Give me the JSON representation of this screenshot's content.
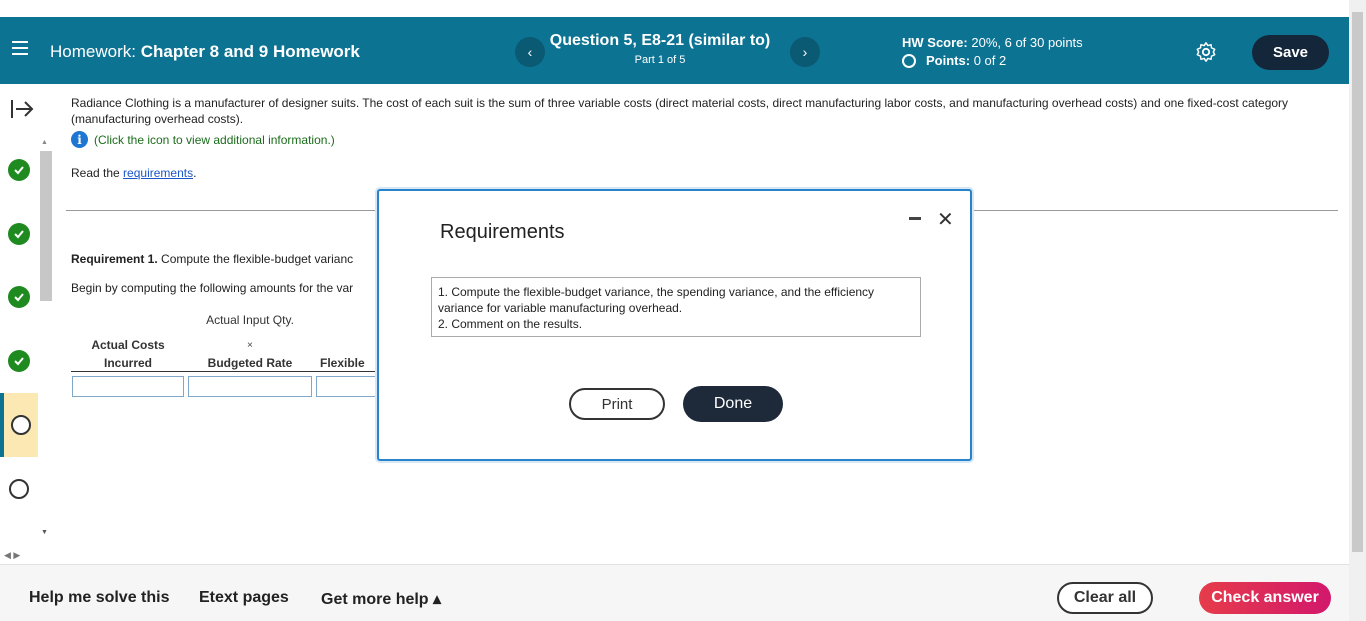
{
  "header": {
    "title_prefix": "Homework:",
    "title_name": "Chapter 8 and 9 Homework",
    "question_title": "Question 5, E8-21 (similar to)",
    "question_part": "Part 1 of 5",
    "hw_score_label": "HW Score:",
    "hw_score_value": "20%, 6 of 30 points",
    "points_label": "Points:",
    "points_value": "0 of 2",
    "prev_label": "‹",
    "next_label": "›",
    "save_label": "Save"
  },
  "sidebar": {
    "items": [
      {
        "status": "complete"
      },
      {
        "status": "complete"
      },
      {
        "status": "complete"
      },
      {
        "status": "complete"
      },
      {
        "status": "current"
      },
      {
        "status": "unanswered"
      }
    ]
  },
  "content": {
    "intro": "Radiance Clothing is a manufacturer of designer suits. The cost of each suit is the sum of three variable costs (direct material costs, direct manufacturing labor costs, and manufacturing overhead costs) and one fixed-cost category (manufacturing overhead costs).",
    "info_text": "(Click the icon to view additional information.)",
    "read_prefix": "Read the",
    "read_link": "requirements",
    "read_suffix": ".",
    "req1_bold": "Requirement 1.",
    "req1_text": "Compute the flexible-budget varianc",
    "begin_text": "Begin by computing the following amounts for the var",
    "col_actual_input": "Actual Input Qty.",
    "col_actual_costs": "Actual Costs",
    "col_incurred": "Incurred",
    "col_times": "×",
    "col_budgeted_rate": "Budgeted Rate",
    "col_flexible": "Flexible"
  },
  "modal": {
    "title": "Requirements",
    "req_1": "1. Compute the flexible-budget variance, the spending variance, and the efficiency variance for variable manufacturing overhead.",
    "req_2": "2. Comment on the results.",
    "print_label": "Print",
    "done_label": "Done",
    "minimize_icon": "minimize-icon",
    "close_icon": "close-icon"
  },
  "footer": {
    "help_label": "Help me solve this",
    "etext_label": "Etext pages",
    "more_help_label": "Get more help ▴",
    "clear_label": "Clear all",
    "check_label": "Check answer"
  },
  "colors": {
    "header_bg": "#0d7393",
    "save_bg": "#14273a",
    "check_gradient_start": "#e63c4a",
    "check_gradient_end": "#d2186c",
    "complete_green": "#1f8a1f"
  }
}
